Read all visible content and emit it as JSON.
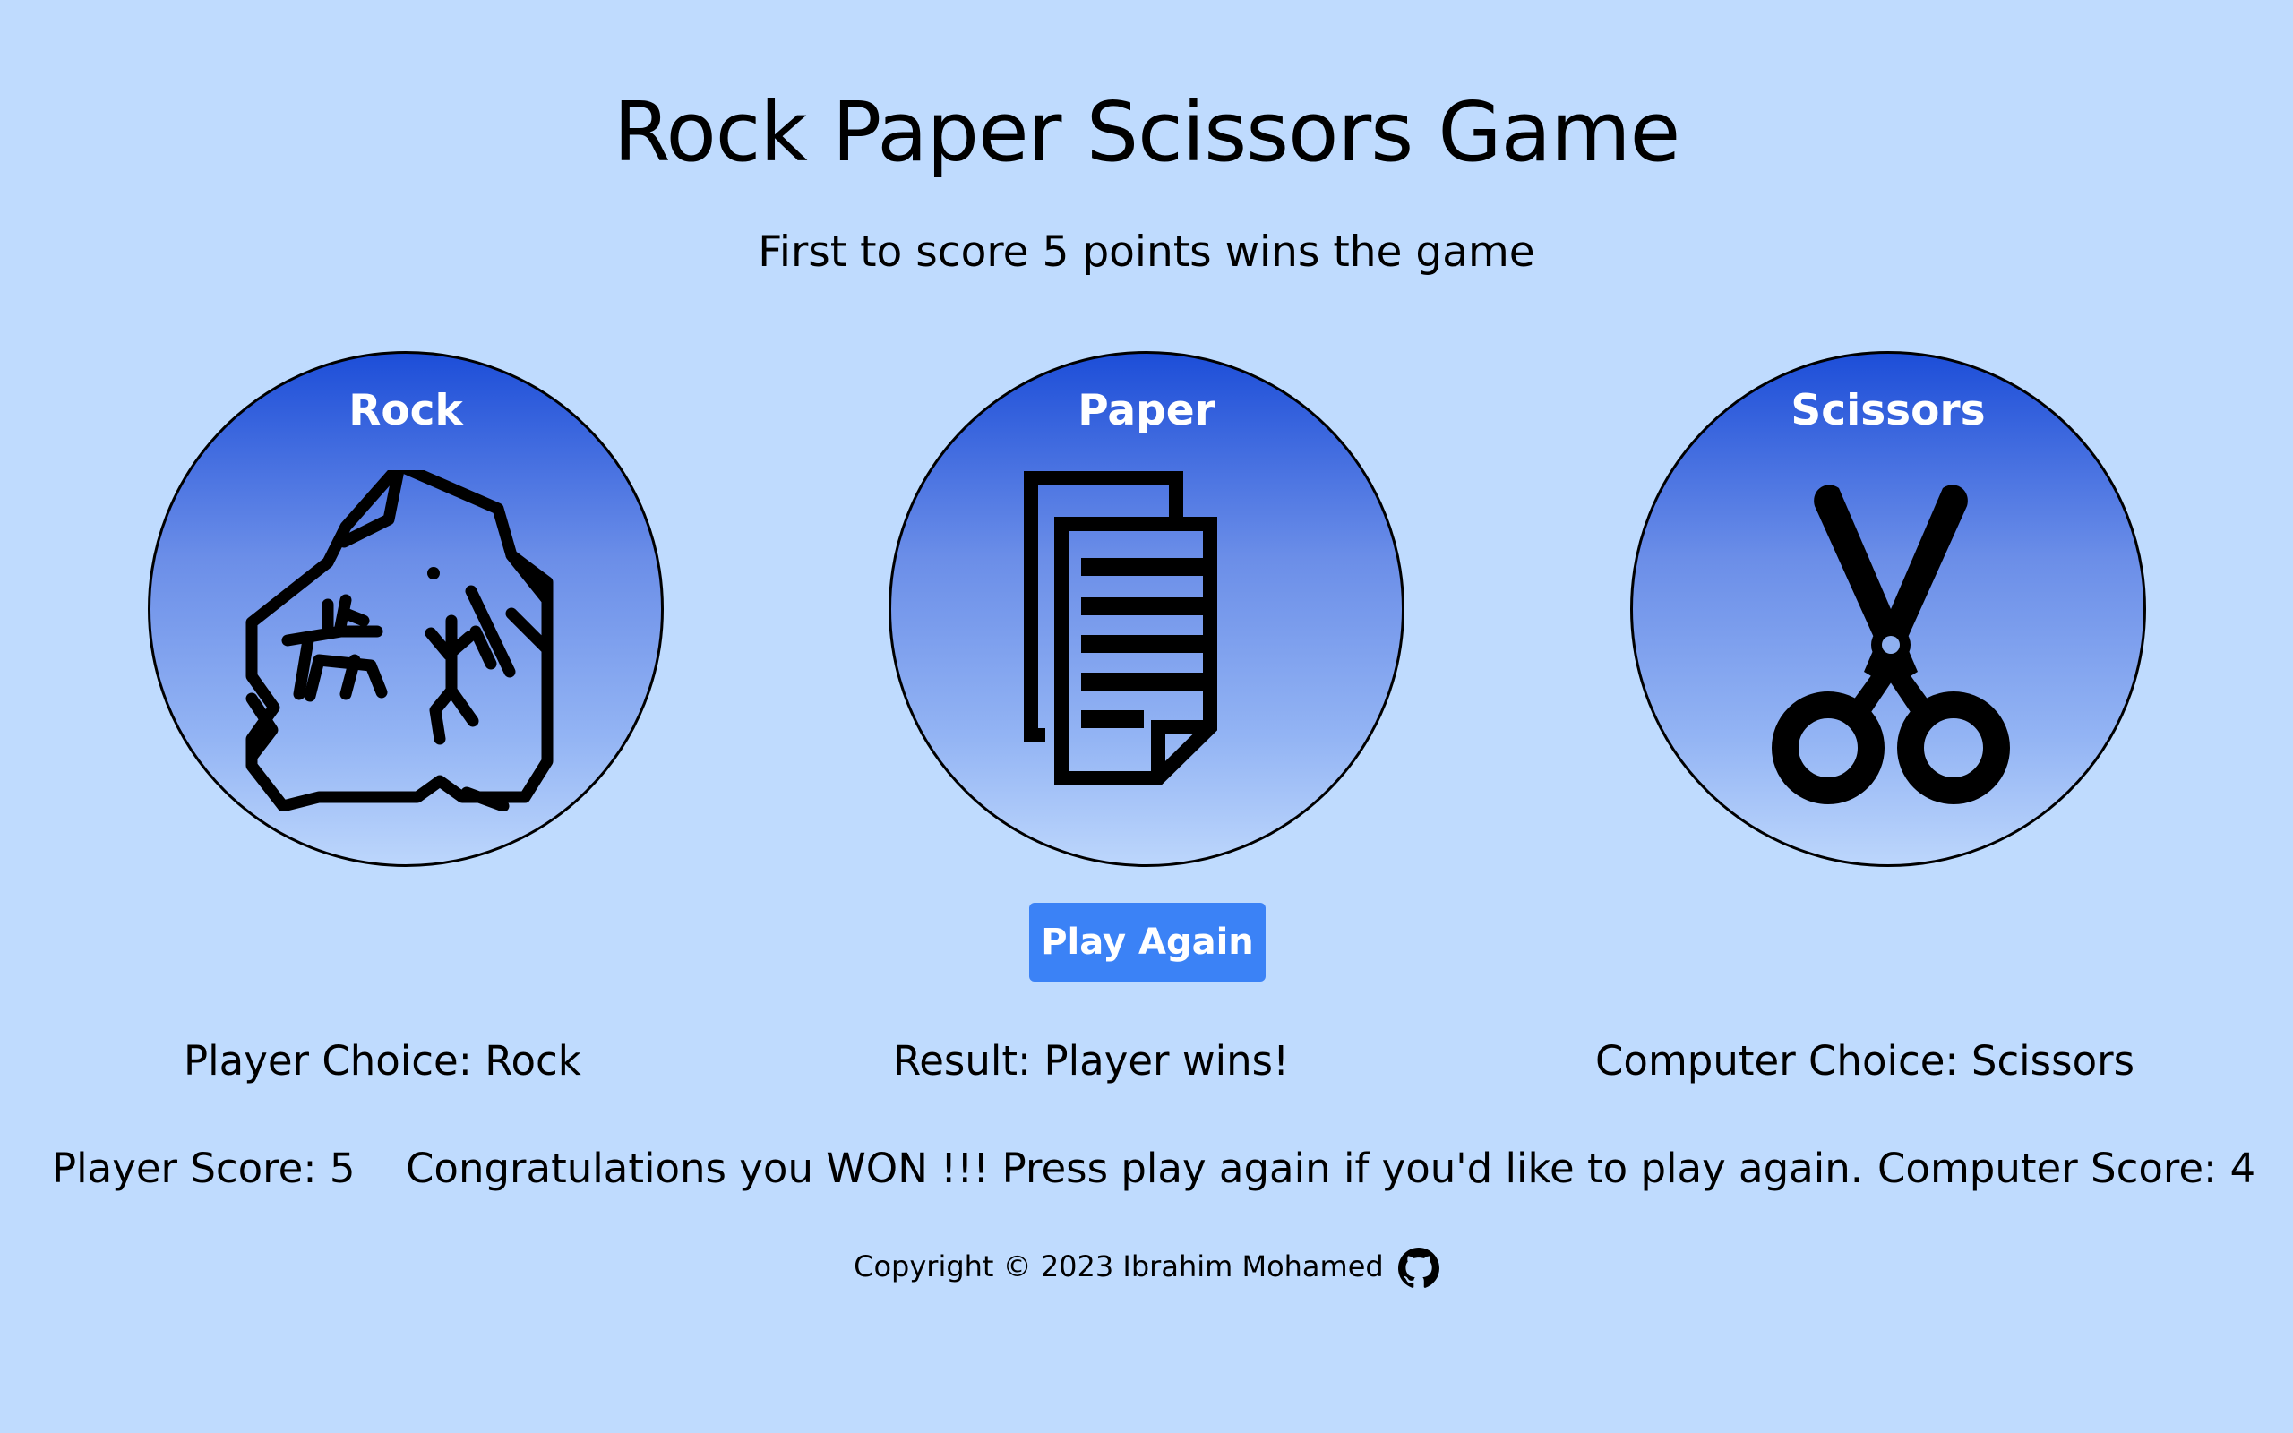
{
  "header": {
    "title": "Rock Paper Scissors Game",
    "subtitle": "First to score 5 points wins the game"
  },
  "choices": [
    {
      "label": "Rock",
      "icon": "cave-rock-icon"
    },
    {
      "label": "Paper",
      "icon": "paper-document-icon"
    },
    {
      "label": "Scissors",
      "icon": "scissors-icon"
    }
  ],
  "play_again_label": "Play Again",
  "status": {
    "player_choice": "Player Choice: Rock",
    "result": "Result: Player wins!",
    "computer_choice": "Computer Choice: Scissors",
    "player_score": "Player Score: 5",
    "message": "Congratulations you WON !!! Press play again if you'd like to play again.",
    "computer_score": "Computer Score: 4"
  },
  "footer": {
    "copyright": "Copyright © 2023 Ibrahim Mohamed",
    "github_icon": "github-icon"
  },
  "colors": {
    "background": "#bfdbfe",
    "circle_top": "#1d4ed8",
    "button": "#3b82f6",
    "text": "#000000"
  }
}
